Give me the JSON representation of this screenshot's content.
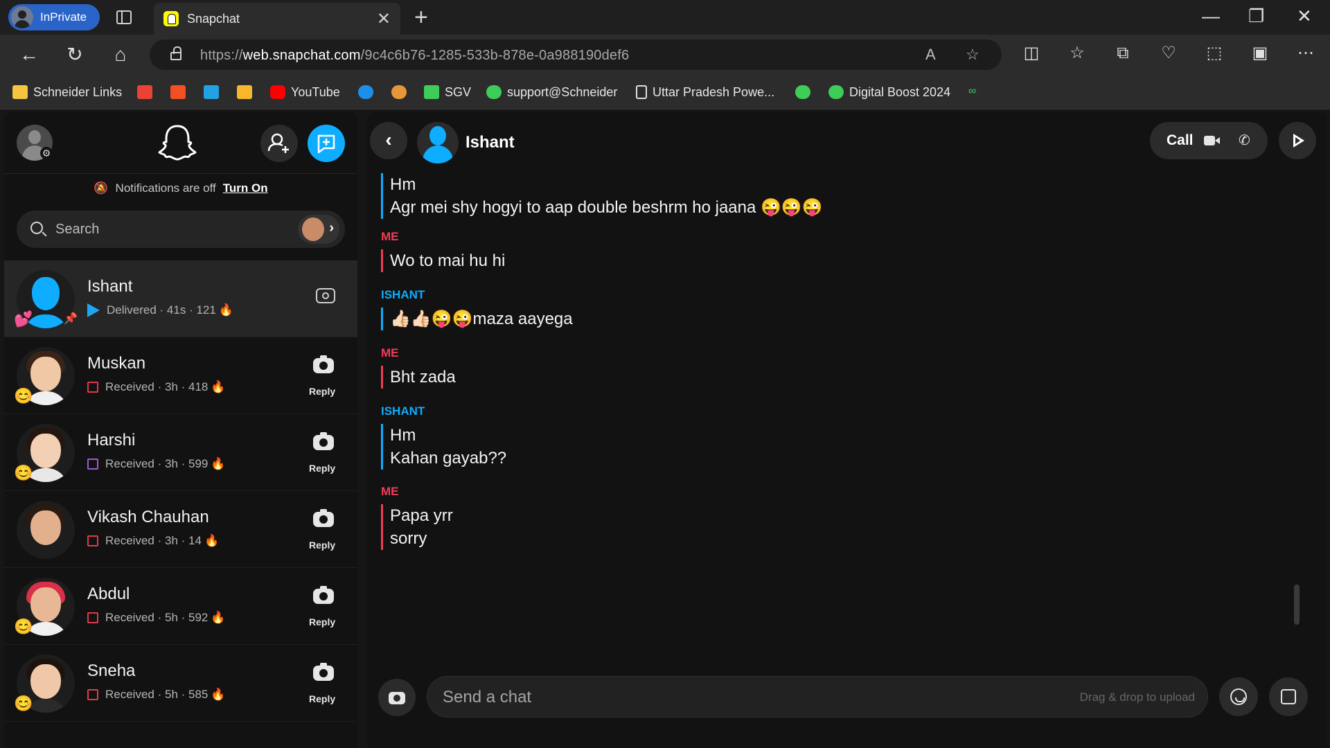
{
  "browser": {
    "inprivate_label": "InPrivate",
    "tab_title": "Snapchat",
    "tab_close": "✕",
    "new_tab": "+",
    "url_prefix": "https://",
    "url_domain": "web.snapchat.com",
    "url_path": "/9c4c6b76-1285-533b-878e-0a988190def6",
    "window_controls": {
      "minimize": "—",
      "restore": "❐",
      "close": "✕"
    },
    "bookmarks": [
      {
        "label": "Schneider Links",
        "icon": "folder-icon",
        "color": "#f5c542"
      },
      {
        "label": "",
        "icon": "gmail-icon",
        "color": "#ea4335"
      },
      {
        "label": "",
        "icon": "office-icon",
        "color": "#f25022"
      },
      {
        "label": "",
        "icon": "teams-icon",
        "color": "#22a1e4"
      },
      {
        "label": "",
        "icon": "c-icon",
        "color": "#f8b72b"
      },
      {
        "label": "YouTube",
        "icon": "youtube-icon",
        "color": "#ff0000"
      },
      {
        "label": "",
        "icon": "onedrive-icon",
        "color": "#1e8fe8"
      },
      {
        "label": "",
        "icon": "burger-icon",
        "color": "#e8963a"
      },
      {
        "label": "SGV",
        "icon": "schneider-icon",
        "color": "#3dcd58"
      },
      {
        "label": "support@Schneider",
        "icon": "schneider-icon",
        "color": "#3dcd58"
      },
      {
        "label": "Uttar Pradesh Powe...",
        "icon": "document-icon",
        "color": "#e0e0e0"
      },
      {
        "label": "",
        "icon": "schneider-icon",
        "color": "#3dcd58"
      },
      {
        "label": "Digital Boost 2024",
        "icon": "schneider-icon",
        "color": "#3dcd58"
      },
      {
        "label": "",
        "icon": "link-icon",
        "color": "#3dcd58"
      }
    ]
  },
  "left": {
    "notifications_text": "Notifications are off",
    "turn_on": "Turn On",
    "search_placeholder": "Search",
    "chats": [
      {
        "name": "Ishant",
        "kind": "delivered",
        "status": "Delivered",
        "time": "41s",
        "streak": "121",
        "emoji": "💕",
        "action": ""
      },
      {
        "name": "Muskan",
        "kind": "received",
        "status": "Received",
        "time": "3h",
        "streak": "418",
        "emoji": "😊",
        "action": "Reply"
      },
      {
        "name": "Harshi",
        "kind": "received-purple",
        "status": "Received",
        "time": "3h",
        "streak": "599",
        "emoji": "😊",
        "action": "Reply"
      },
      {
        "name": "Vikash Chauhan",
        "kind": "received",
        "status": "Received",
        "time": "3h",
        "streak": "14",
        "emoji": "",
        "action": "Reply"
      },
      {
        "name": "Abdul",
        "kind": "received",
        "status": "Received",
        "time": "5h",
        "streak": "592",
        "emoji": "😊",
        "action": "Reply"
      },
      {
        "name": "Sneha",
        "kind": "received",
        "status": "Received",
        "time": "5h",
        "streak": "585",
        "emoji": "😊",
        "action": "Reply"
      }
    ]
  },
  "conversation": {
    "peer_name": "Ishant",
    "call_label": "Call",
    "messages": [
      {
        "sender": "",
        "side": "them",
        "lines": [
          "Hm",
          "Agr mei shy hogyi to aap double beshrm ho jaana 😜😜😜"
        ]
      },
      {
        "sender": "ME",
        "side": "me",
        "lines": [
          "Wo to mai hu hi"
        ]
      },
      {
        "sender": "ISHANT",
        "side": "them",
        "lines": [
          "👍🏻👍🏻😜😜maza aayega"
        ]
      },
      {
        "sender": "ME",
        "side": "me",
        "lines": [
          "Bht zada"
        ]
      },
      {
        "sender": "ISHANT",
        "side": "them",
        "lines": [
          "Hm",
          "Kahan gayab??"
        ]
      },
      {
        "sender": "ME",
        "side": "me",
        "lines": [
          "Papa yrr",
          "sorry"
        ]
      }
    ],
    "composer_placeholder": "Send a chat",
    "drag_drop_hint": "Drag & drop to upload"
  }
}
